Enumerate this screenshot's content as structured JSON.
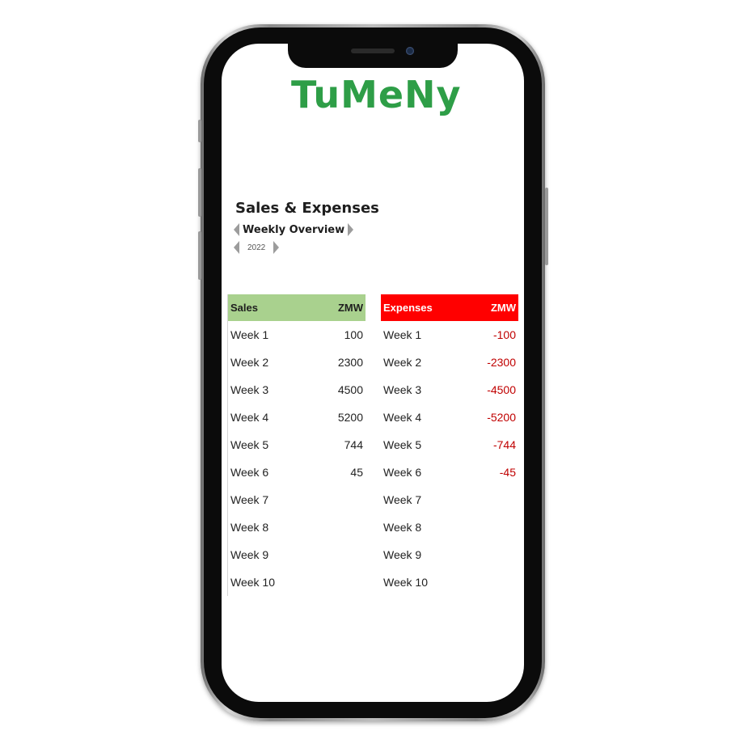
{
  "app": {
    "logo_text": "TuMeNy"
  },
  "header": {
    "title": "Sales & Expenses",
    "view_label": "Weekly Overview",
    "year_label": "2022"
  },
  "sales": {
    "header_label": "Sales",
    "currency": "ZMW",
    "rows": [
      {
        "week": "Week 1",
        "value": "100"
      },
      {
        "week": "Week 2",
        "value": "2300"
      },
      {
        "week": "Week 3",
        "value": "4500"
      },
      {
        "week": "Week 4",
        "value": "5200"
      },
      {
        "week": "Week 5",
        "value": "744"
      },
      {
        "week": "Week 6",
        "value": "45"
      },
      {
        "week": "Week 7",
        "value": ""
      },
      {
        "week": "Week 8",
        "value": ""
      },
      {
        "week": "Week 9",
        "value": ""
      },
      {
        "week": "Week 10",
        "value": ""
      }
    ]
  },
  "expenses": {
    "header_label": "Expenses",
    "currency": "ZMW",
    "rows": [
      {
        "week": "Week 1",
        "value": "-100"
      },
      {
        "week": "Week 2",
        "value": "-2300"
      },
      {
        "week": "Week 3",
        "value": "-4500"
      },
      {
        "week": "Week 4",
        "value": "-5200"
      },
      {
        "week": "Week 5",
        "value": "-744"
      },
      {
        "week": "Week 6",
        "value": "-45"
      },
      {
        "week": "Week 7",
        "value": ""
      },
      {
        "week": "Week 8",
        "value": ""
      },
      {
        "week": "Week 9",
        "value": ""
      },
      {
        "week": "Week 10",
        "value": ""
      }
    ]
  },
  "colors": {
    "brand_green": "#2e9e47",
    "sales_header": "#a9d18e",
    "expenses_header": "#ff0000",
    "expense_value": "#c00000"
  }
}
